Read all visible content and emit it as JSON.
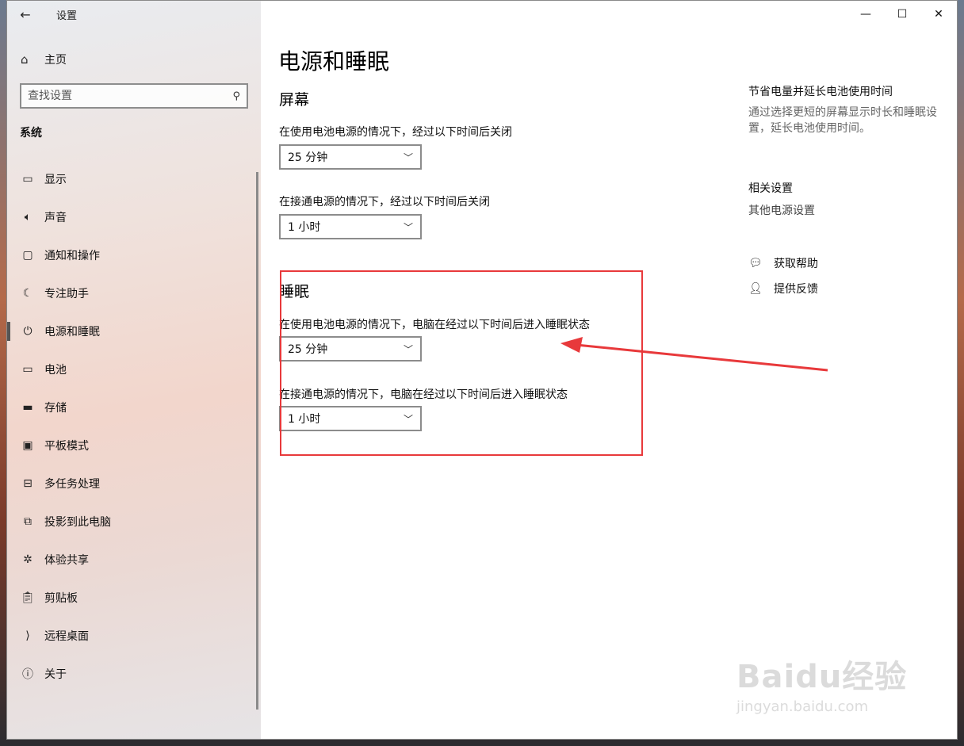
{
  "window": {
    "title": "设置"
  },
  "sidebar": {
    "home_label": "主页",
    "search_placeholder": "查找设置",
    "section": "系统",
    "items": [
      {
        "label": "显示",
        "icon": "display-icon"
      },
      {
        "label": "声音",
        "icon": "speaker-icon"
      },
      {
        "label": "通知和操作",
        "icon": "notification-icon"
      },
      {
        "label": "专注助手",
        "icon": "moon-icon"
      },
      {
        "label": "电源和睡眠",
        "icon": "power-icon",
        "active": true
      },
      {
        "label": "电池",
        "icon": "battery-icon"
      },
      {
        "label": "存储",
        "icon": "storage-icon"
      },
      {
        "label": "平板模式",
        "icon": "tablet-icon"
      },
      {
        "label": "多任务处理",
        "icon": "multitask-icon"
      },
      {
        "label": "投影到此电脑",
        "icon": "project-icon"
      },
      {
        "label": "体验共享",
        "icon": "share-icon"
      },
      {
        "label": "剪贴板",
        "icon": "clipboard-icon"
      },
      {
        "label": "远程桌面",
        "icon": "remote-desktop-icon"
      },
      {
        "label": "关于",
        "icon": "info-icon"
      }
    ]
  },
  "main": {
    "page_title": "电源和睡眠",
    "screen": {
      "heading": "屏幕",
      "battery_label": "在使用电池电源的情况下，经过以下时间后关闭",
      "battery_value": "25 分钟",
      "plugged_label": "在接通电源的情况下，经过以下时间后关闭",
      "plugged_value": "1 小时"
    },
    "sleep": {
      "heading": "睡眠",
      "battery_label": "在使用电池电源的情况下，电脑在经过以下时间后进入睡眠状态",
      "battery_value": "25 分钟",
      "plugged_label": "在接通电源的情况下，电脑在经过以下时间后进入睡眠状态",
      "plugged_value": "1 小时"
    }
  },
  "aside": {
    "tip_heading": "节省电量并延长电池使用时间",
    "tip_text": "通过选择更短的屏幕显示时长和睡眠设置，延长电池使用时间。",
    "related_heading": "相关设置",
    "related_link": "其他电源设置",
    "help_label": "获取帮助",
    "feedback_label": "提供反馈"
  },
  "watermark": {
    "brand": "Baidu经验",
    "url": "jingyan.baidu.com"
  },
  "colors": {
    "highlight": "#e8393b",
    "accent_bar": "#555555"
  }
}
